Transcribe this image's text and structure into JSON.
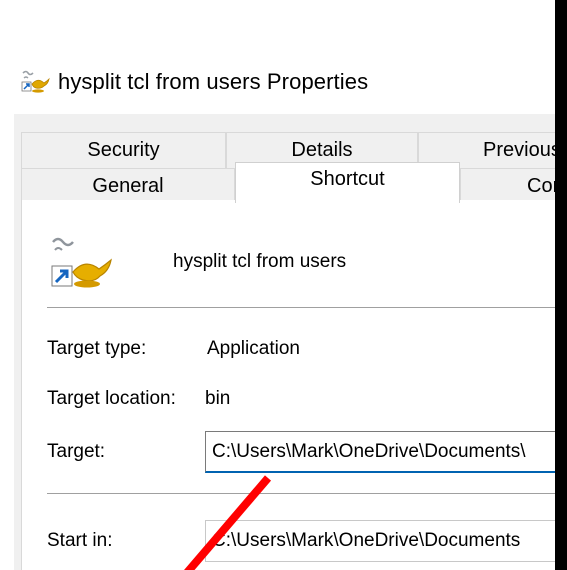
{
  "window": {
    "title": "hysplit tcl from users Properties",
    "icon": "shortcut-lamp-icon"
  },
  "tabs": {
    "row1": [
      "Security",
      "Details",
      "Previous"
    ],
    "row2": [
      "General",
      "Shortcut",
      "Com"
    ],
    "active": "Shortcut"
  },
  "shortcut": {
    "name": "hysplit tcl from users",
    "target_type_label": "Target type:",
    "target_type_value": "Application",
    "target_location_label": "Target location:",
    "target_location_value": "bin",
    "target_label": "Target:",
    "target_value": "C:\\Users\\Mark\\OneDrive\\Documents\\",
    "start_in_label": "Start in:",
    "start_in_value": "C:\\Users\\Mark\\OneDrive\\Documents"
  },
  "annotation": {
    "color": "#ff0000"
  }
}
